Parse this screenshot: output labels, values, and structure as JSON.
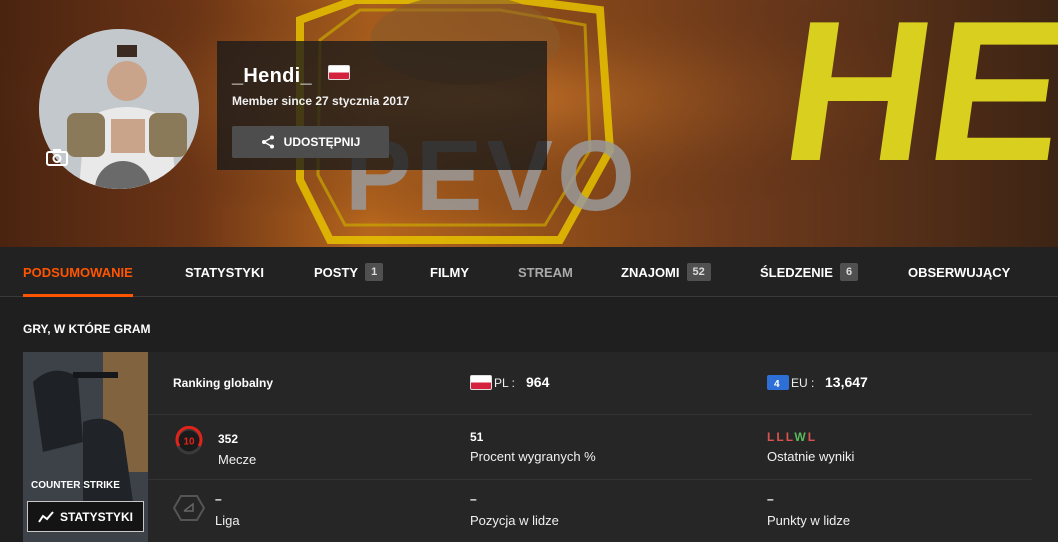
{
  "profile": {
    "username": "_Hendi_",
    "country_flag": "pl-flag",
    "member_since": "Member since 27 stycznia 2017",
    "share_label": "UDOSTĘPNIJ",
    "banner_text": "PEVO",
    "banner_text_right": "HE"
  },
  "tabs": [
    {
      "label": "PODSUMOWANIE",
      "active": true
    },
    {
      "label": "STATYSTYKI"
    },
    {
      "label": "POSTY",
      "count": "1"
    },
    {
      "label": "FILMY"
    },
    {
      "label": "STREAM"
    },
    {
      "label": "ZNAJOMI",
      "count": "52"
    },
    {
      "label": "ŚLEDZENIE",
      "count": "6"
    },
    {
      "label": "OBSERWUJĄCY"
    }
  ],
  "games_section": {
    "title": "GRY, W KTÓRE GRAM",
    "cover_title": "COUNTER STRIKE",
    "stats_button": "STATYSTYKI",
    "ranking_label": "Ranking globalny",
    "pl_rank_label": "PL :",
    "pl_rank_value": "964",
    "eu_rank_label": "EU :",
    "eu_rank_value": "13,647",
    "level_value": "10",
    "matches_value": "352",
    "matches_label": "Mecze",
    "winrate_value": "51",
    "winrate_label": "Procent wygranych %",
    "recent_results": [
      "L",
      "L",
      "L",
      "W",
      "L"
    ],
    "recent_label": "Ostatnie wyniki",
    "league_value": "–",
    "league_label": "Liga",
    "position_value": "–",
    "position_label": "Pozycja w lidze",
    "points_value": "–",
    "points_label": "Punkty w lidze"
  },
  "colors": {
    "accent": "#ff5500",
    "win": "#5cb85c",
    "loss": "#d9534f",
    "level_red": "#e2231a"
  }
}
